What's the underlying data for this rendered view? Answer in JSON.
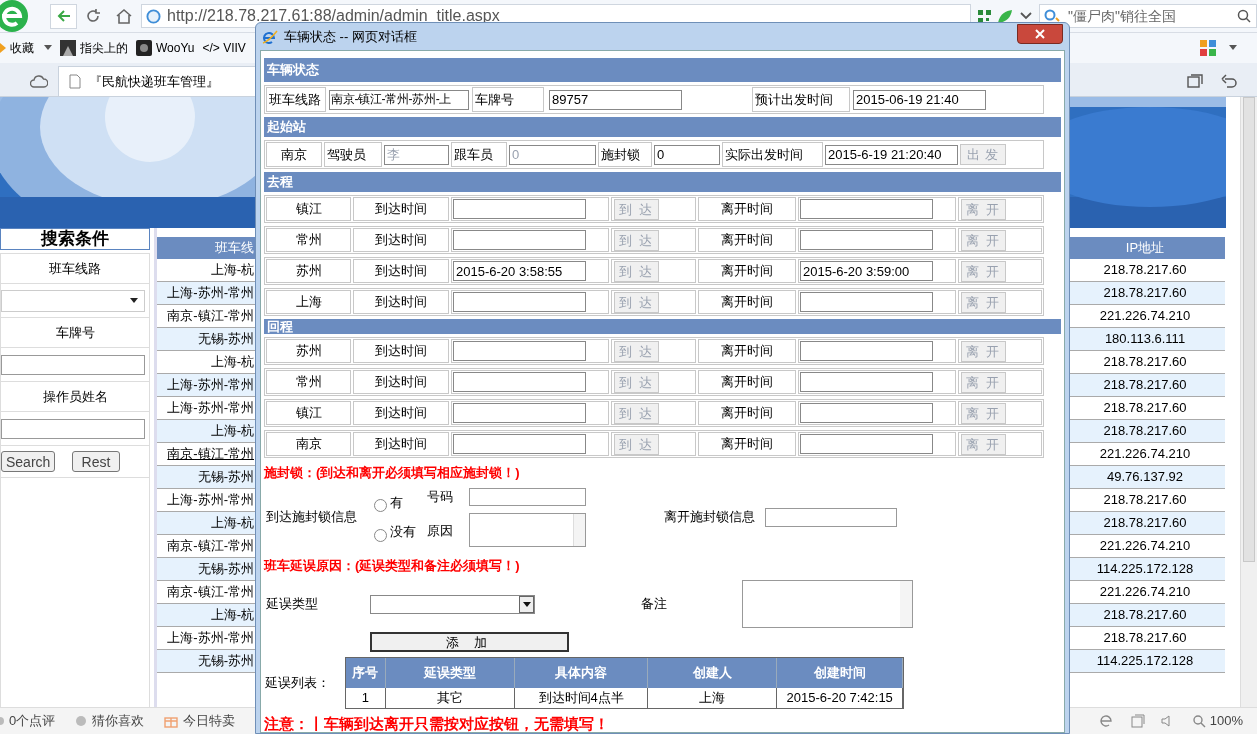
{
  "browser": {
    "url": "http://218.78.217.61:88/admin/admin_title.aspx",
    "search_placeholder": "\"僵尸肉\"销往全国",
    "bookmarks": [
      {
        "label": "收藏"
      },
      {
        "label": "指尖上的"
      },
      {
        "label": "WooYu"
      },
      {
        "label": "</> VIIV"
      }
    ],
    "tab": {
      "title": "『民航快递班车管理』",
      "selected": true
    }
  },
  "search_panel": {
    "title": "搜索条件",
    "fields": [
      {
        "label": "班车线路",
        "kind": "select"
      },
      {
        "label": "车牌号",
        "kind": "input"
      },
      {
        "label": "操作员姓名",
        "kind": "input"
      }
    ],
    "buttons": [
      "Search",
      "Rest"
    ]
  },
  "table": {
    "columns": [
      "班车线",
      "IP地址"
    ],
    "rows": [
      {
        "route": "上海-杭",
        "ip": "218.78.217.60",
        "hovered": false
      },
      {
        "route": "上海-苏州-常州",
        "ip": "218.78.217.60",
        "hovered": false
      },
      {
        "route": "南京-镇江-常州",
        "ip": "221.226.74.210",
        "hovered": false
      },
      {
        "route": "无锡-苏州",
        "ip": "180.113.6.111",
        "hovered": false
      },
      {
        "route": "上海-杭",
        "ip": "218.78.217.60",
        "hovered": false
      },
      {
        "route": "上海-苏州-常州",
        "ip": "218.78.217.60",
        "hovered": false
      },
      {
        "route": "上海-苏州-常州",
        "ip": "218.78.217.60",
        "hovered": false
      },
      {
        "route": "上海-杭",
        "ip": "218.78.217.60",
        "hovered": false
      },
      {
        "route": "南京-镇江-常州",
        "ip": "221.226.74.210",
        "hovered": true
      },
      {
        "route": "无锡-苏州",
        "ip": "49.76.137.92",
        "hovered": false
      },
      {
        "route": "上海-苏州-常州",
        "ip": "218.78.217.60",
        "hovered": false
      },
      {
        "route": "上海-杭",
        "ip": "218.78.217.60",
        "hovered": false
      },
      {
        "route": "南京-镇江-常州",
        "ip": "221.226.74.210",
        "hovered": false
      },
      {
        "route": "无锡-苏州",
        "ip": "114.225.172.128",
        "hovered": false
      },
      {
        "route": "南京-镇江-常州",
        "ip": "221.226.74.210",
        "hovered": false
      },
      {
        "route": "上海-杭",
        "ip": "218.78.217.60",
        "hovered": false
      },
      {
        "route": "上海-苏州-常州",
        "ip": "218.78.217.60",
        "hovered": false
      },
      {
        "route": "无锡-苏州",
        "ip": "114.225.172.128",
        "hovered": false
      }
    ]
  },
  "dialog": {
    "title": "车辆状态 -- 网页对话框",
    "vehicle": {
      "heading": "车辆状态",
      "route_label": "班车线路",
      "route_value": "南京-镇江-常州-苏州-上",
      "plate_label": "车牌号",
      "plate_value": "89757",
      "planned_label": "预计出发时间",
      "planned_value": "2015-06-19 21:40"
    },
    "start": {
      "heading": "起始站",
      "station": "南京",
      "driver_label": "驾驶员",
      "driver_value": "李",
      "driver_disabled": true,
      "attendant_label": "跟车员",
      "attendant_value": "0",
      "attendant_disabled": true,
      "seal_label": "施封锁",
      "seal_value": "0",
      "actual_label": "实际出发时间",
      "actual_value": "2015-6-19 21:20:40",
      "depart_button": "出 发",
      "depart_disabled": true
    },
    "legs": [
      {
        "heading": "去程",
        "stops": [
          {
            "station": "镇江",
            "arrive_label": "到达时间",
            "arrive_button": "到 达",
            "leave_label": "离开时间",
            "leave_button": "离 开",
            "disabled": true
          },
          {
            "station": "常州",
            "arrive_label": "到达时间",
            "arrive_button": "到 达",
            "leave_label": "离开时间",
            "leave_button": "离 开",
            "disabled": true
          },
          {
            "station": "苏州",
            "arrive_label": "到达时间",
            "arrive_value": "2015-6-20 3:58:55",
            "arrive_button": "到 达",
            "leave_label": "离开时间",
            "leave_value": "2015-6-20 3:59:00",
            "leave_button": "离 开",
            "disabled": true
          },
          {
            "station": "上海",
            "arrive_label": "到达时间",
            "arrive_button": "到 达",
            "leave_label": "离开时间",
            "leave_button": "离 开",
            "disabled": true
          }
        ]
      },
      {
        "heading": "回程",
        "stops": [
          {
            "station": "苏州",
            "arrive_label": "到达时间",
            "arrive_button": "到 达",
            "leave_label": "离开时间",
            "leave_button": "离 开",
            "disabled": true
          },
          {
            "station": "常州",
            "arrive_label": "到达时间",
            "arrive_button": "到 达",
            "leave_label": "离开时间",
            "leave_button": "离 开",
            "disabled": true
          },
          {
            "station": "镇江",
            "arrive_label": "到达时间",
            "arrive_button": "到 达",
            "leave_label": "离开时间",
            "leave_button": "离 开",
            "disabled": true
          },
          {
            "station": "南京",
            "arrive_label": "到达时间",
            "arrive_button": "到 达",
            "leave_label": "离开时间",
            "leave_button": "离 开",
            "disabled": true
          }
        ]
      }
    ],
    "seal": {
      "warning": "施封锁：(到达和离开必须填写相应施封锁！)",
      "arrive_label": "到达施封锁信息",
      "options": [
        {
          "label": "有",
          "selected": false
        },
        {
          "label": "没有",
          "selected": false
        }
      ],
      "number_label": "号码",
      "reason_label": "原因",
      "leave_label": "离开施封锁信息"
    },
    "delay": {
      "warning": "班车延误原因：(延误类型和备注必须填写！)",
      "type_label": "延误类型",
      "remark_label": "备注",
      "add_button": "添 加",
      "list_label": "延误列表：",
      "columns": [
        "序号",
        "延误类型",
        "具体内容",
        "创建人",
        "创建时间"
      ],
      "rows": [
        [
          "1",
          "其它",
          "到达时间4点半",
          "上海",
          "2015-6-20 7:42:15"
        ]
      ]
    },
    "note": "注意：丨车辆到达离开只需按对应按钮，无需填写！"
  },
  "status_bar": {
    "items": [
      "0个点评",
      "猜你喜欢",
      "今日特卖"
    ],
    "zoom": "100%"
  }
}
